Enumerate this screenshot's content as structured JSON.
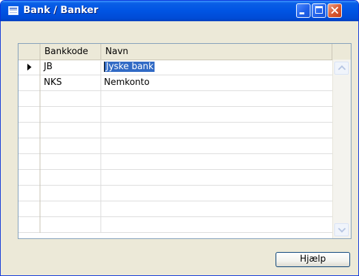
{
  "window": {
    "title": "Bank / Banker"
  },
  "columns": {
    "code": "Bankkode",
    "name": "Navn"
  },
  "rows": [
    {
      "code": "JB",
      "name": "Jyske bank",
      "selected": true
    },
    {
      "code": "NKS",
      "name": "Nemkonto",
      "selected": false
    }
  ],
  "empty_row_count": 9,
  "buttons": {
    "help": "Hjælp"
  },
  "colors": {
    "titlebar": "#0054e3",
    "selection": "#316ac5",
    "window_bg": "#ece9d8"
  }
}
